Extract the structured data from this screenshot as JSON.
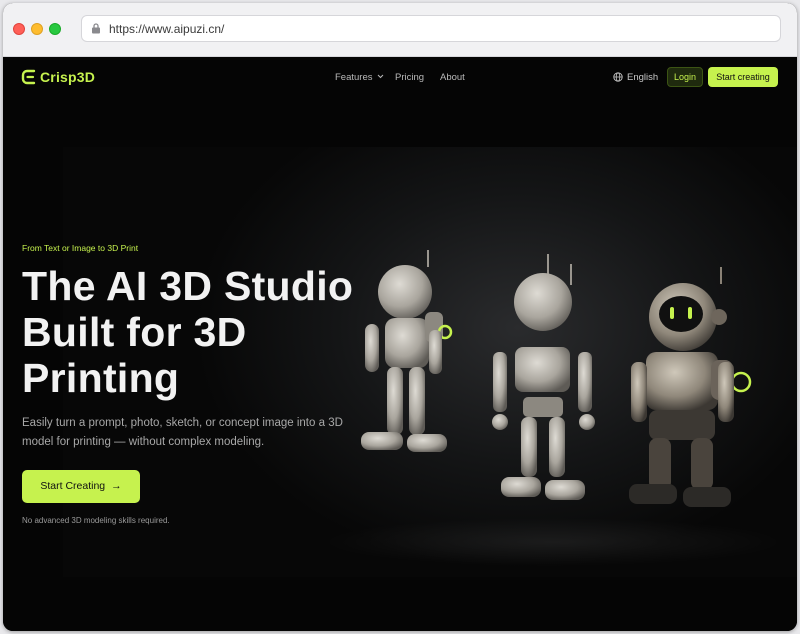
{
  "browser": {
    "url": "https://www.aipuzi.cn/"
  },
  "nav": {
    "brand": "Crisp3D",
    "links": [
      {
        "label": "Features"
      },
      {
        "label": "Pricing"
      },
      {
        "label": "About"
      }
    ],
    "language": "English",
    "login": "Login",
    "cta": "Start creating"
  },
  "hero": {
    "eyebrow": "From Text or Image to 3D Print",
    "headline": "The AI 3D Studio\nBuilt for 3D\nPrinting",
    "subtext": "Easily turn a prompt, photo, sketch, or concept image into a 3D model for printing — without complex modeling.",
    "cta": "Start Creating",
    "note": "No advanced 3D modeling skills required."
  },
  "colors": {
    "accent": "#c6f24e",
    "background": "#050505"
  },
  "icons": [
    "lock-icon",
    "logo-icon",
    "chevron-down-icon",
    "globe-icon",
    "arrow-right-icon"
  ]
}
